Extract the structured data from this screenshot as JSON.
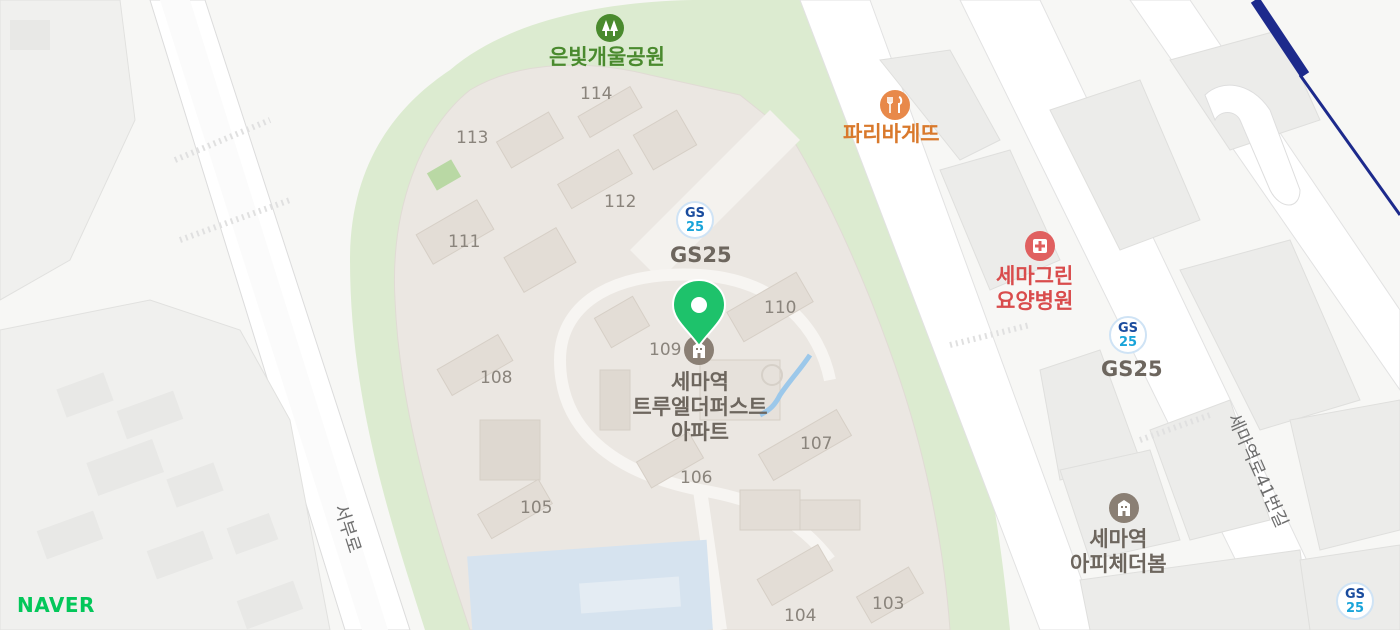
{
  "brand": {
    "logo_text": "NAVER",
    "color": "#03c75a"
  },
  "colors": {
    "park": "#dcebd0",
    "complex": "#ebe7e2",
    "road": "#ffffff",
    "marker": "#1ec26b",
    "subway": "#1d2a8c"
  },
  "map": {
    "parks": [
      {
        "label": "은빛개울공원",
        "icon": "park-tree-icon"
      }
    ],
    "selected_place": {
      "label_lines": [
        "세마역",
        "트루엘더퍼스트",
        "아파트"
      ],
      "icon": "apartment-icon",
      "marker_icon": "location-pin-icon"
    },
    "pois": {
      "bakery": {
        "label": "파리바게뜨",
        "icon": "restaurant-icon"
      },
      "hospital": {
        "label_lines": [
          "세마그린",
          "요양병원"
        ],
        "icon": "hospital-icon"
      },
      "gs25_a": {
        "label": "GS25",
        "icon_text": [
          "GS",
          "25"
        ]
      },
      "gs25_b": {
        "label": "GS25",
        "icon_text": [
          "GS",
          "25"
        ]
      },
      "gs25_c": {
        "icon_text": [
          "GS",
          "25"
        ]
      },
      "apartment2": {
        "label_lines": [
          "세마역",
          "아피체더봄"
        ],
        "icon": "apartment-icon"
      }
    },
    "roads": {
      "west": "서부로",
      "east": "세마역로41번길"
    },
    "building_numbers": [
      "114",
      "113",
      "112",
      "111",
      "110",
      "109",
      "108",
      "107",
      "106",
      "105",
      "104",
      "103"
    ]
  }
}
